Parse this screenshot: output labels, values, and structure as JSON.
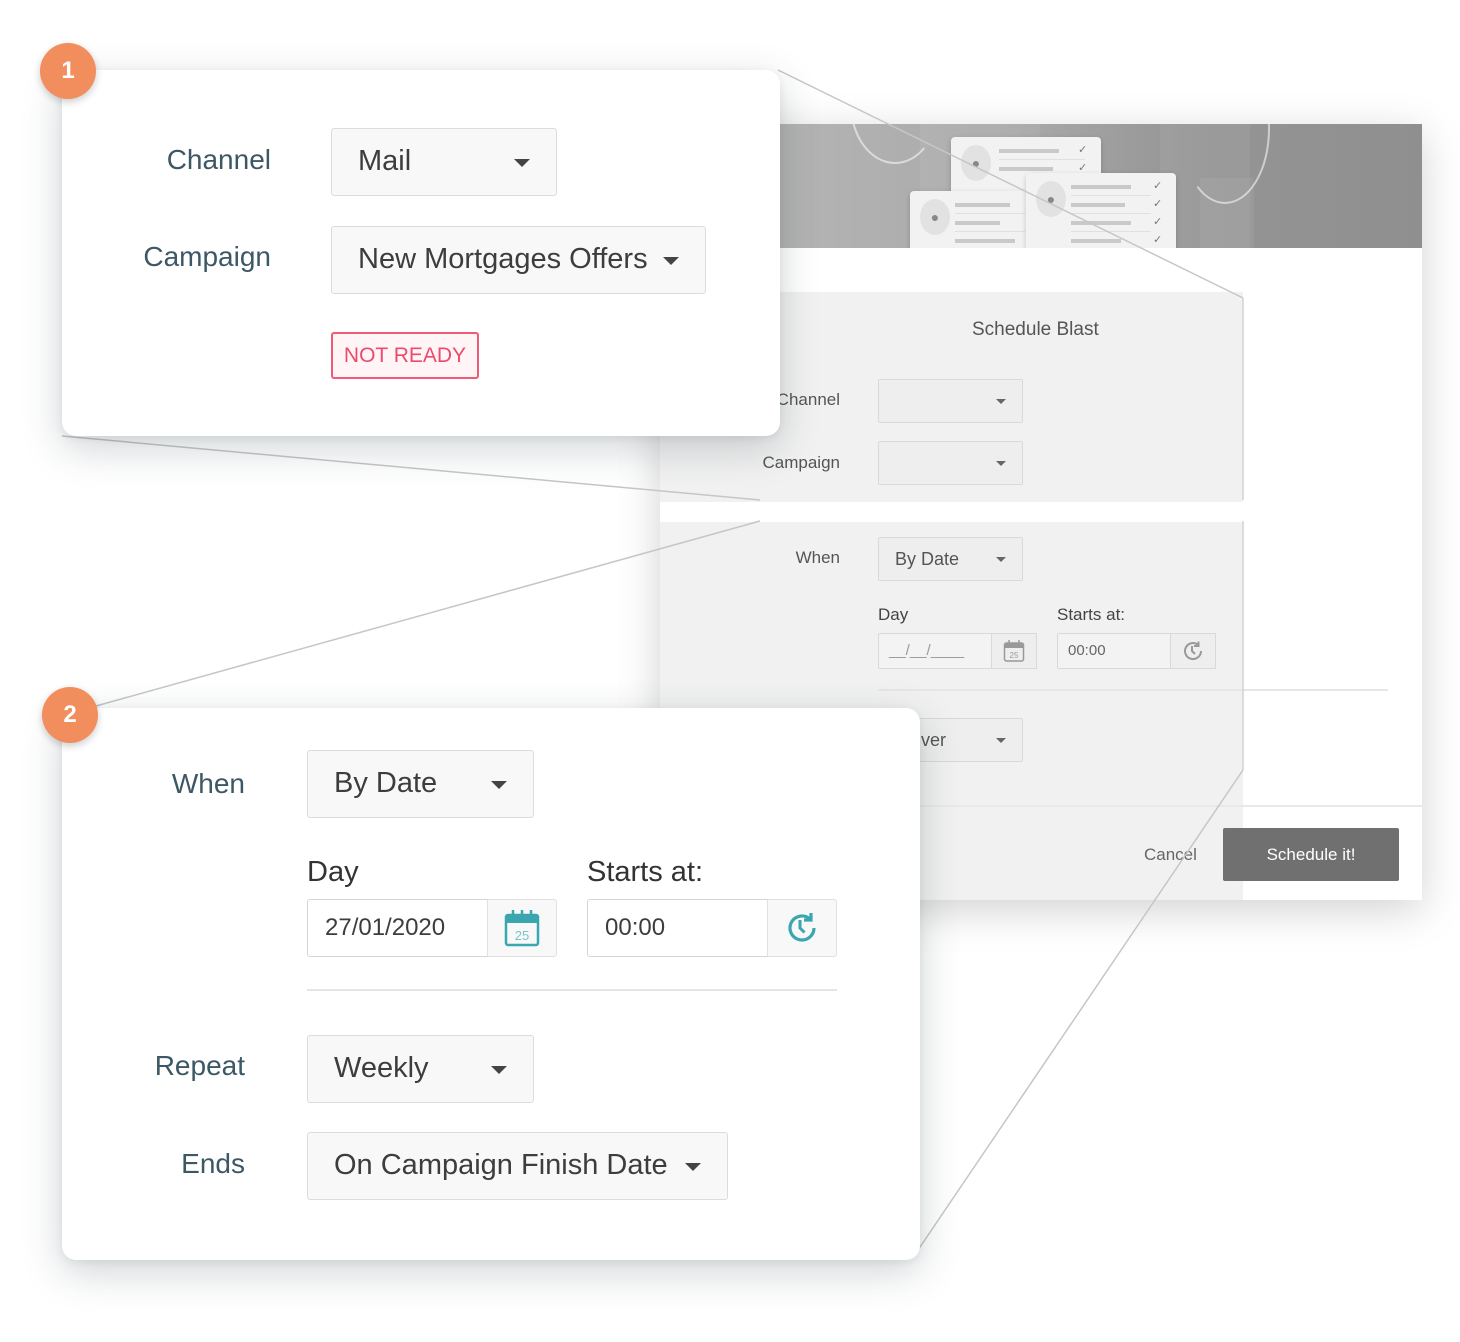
{
  "background_dialog": {
    "title": "Schedule Blast",
    "channel_label": "Channel",
    "campaign_label": "Campaign",
    "channel_value": "",
    "campaign_value": "",
    "when_label": "When",
    "when_value": "By Date",
    "day_label": "Day",
    "day_placeholder": "__/__/____",
    "starts_label": "Starts at:",
    "starts_value": "00:00",
    "calendar_day": "25",
    "repeat_partial_value": "ver",
    "cancel_label": "Cancel",
    "schedule_label": "Schedule it!"
  },
  "callout_1": {
    "badge": "1",
    "channel_label": "Channel",
    "channel_value": "Mail",
    "campaign_label": "Campaign",
    "campaign_value": "New Mortgages Offers",
    "status": "NOT READY"
  },
  "callout_2": {
    "badge": "2",
    "when_label": "When",
    "when_value": "By Date",
    "day_label": "Day",
    "day_value": "27/01/2020",
    "calendar_day": "25",
    "starts_label": "Starts at:",
    "starts_value": "00:00",
    "repeat_label": "Repeat",
    "repeat_value": "Weekly",
    "ends_label": "Ends",
    "ends_value": "On Campaign Finish Date"
  },
  "colors": {
    "badge": "#f28d5e",
    "label_text": "#3c5865",
    "not_ready": "#ec4b6c",
    "icon_accent": "#3aa6b0",
    "primary_button": "#707070"
  }
}
